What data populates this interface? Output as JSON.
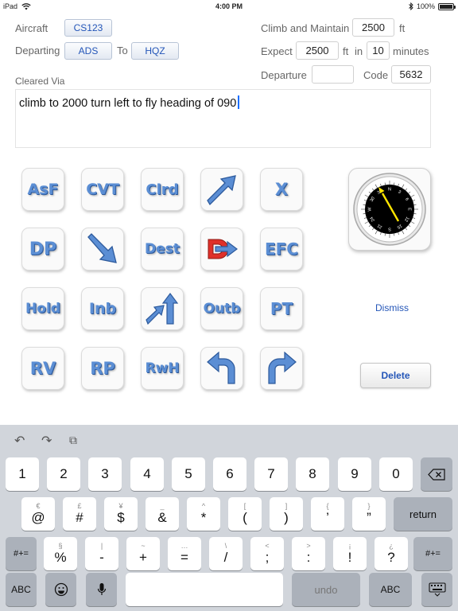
{
  "status": {
    "device": "iPad",
    "time": "4:00 PM",
    "battery": "100%",
    "battery_level": 1.0
  },
  "form": {
    "aircraft_label": "Aircraft",
    "aircraft_value": "CS123",
    "departing_label": "Departing",
    "departing_value": "ADS",
    "to_label": "To",
    "to_value": "HQZ",
    "cleared_via_label": "Cleared Via",
    "climb_label": "Climb and Maintain",
    "climb_value": "2500",
    "climb_unit": "ft",
    "expect_label": "Expect",
    "expect_value": "2500",
    "expect_unit": "ft",
    "in_label": "in",
    "in_value": "10",
    "minutes_label": "minutes",
    "departure_label": "Departure",
    "departure_value": "",
    "code_label": "Code",
    "code_value": "5632"
  },
  "clearance_text": "climb to 2000 turn left to  fly heading of 090",
  "tiles": [
    {
      "label": "AsF"
    },
    {
      "label": "CVT"
    },
    {
      "label": "Clrd"
    },
    {
      "icon": "arrow-up-right-icon"
    },
    {
      "label": "X"
    },
    {
      "label": "DP"
    },
    {
      "icon": "arrow-down-right-icon"
    },
    {
      "label": "Dest"
    },
    {
      "icon": "d-arrow-icon"
    },
    {
      "label": "EFC"
    },
    {
      "label": "Hold"
    },
    {
      "label": "Inb"
    },
    {
      "icon": "double-arrow-up-right-icon"
    },
    {
      "label": "Outb"
    },
    {
      "label": "PT"
    },
    {
      "label": "RV"
    },
    {
      "label": "RP"
    },
    {
      "label": "RwH"
    },
    {
      "icon": "turn-left-arrow-icon"
    },
    {
      "icon": "turn-right-arrow-icon"
    }
  ],
  "compass": {
    "labels": [
      "N",
      "3",
      "6",
      "E",
      "12",
      "15",
      "S",
      "21",
      "24",
      "W",
      "30",
      "33"
    ]
  },
  "dismiss_label": "Dismiss",
  "delete_label": "Delete",
  "keyboard": {
    "row1": [
      "1",
      "2",
      "3",
      "4",
      "5",
      "6",
      "7",
      "8",
      "9",
      "0"
    ],
    "row2": [
      {
        "main": "@",
        "sub": "€"
      },
      {
        "main": "#",
        "sub": "£"
      },
      {
        "main": "$",
        "sub": "¥"
      },
      {
        "main": "&",
        "sub": "_"
      },
      {
        "main": "*",
        "sub": "^"
      },
      {
        "main": "(",
        "sub": "["
      },
      {
        "main": ")",
        "sub": "]"
      },
      {
        "main": "’",
        "sub": "{"
      },
      {
        "main": "”",
        "sub": "}"
      }
    ],
    "row3": [
      {
        "main": "%",
        "sub": "§"
      },
      {
        "main": "-",
        "sub": "|"
      },
      {
        "main": "+",
        "sub": "~"
      },
      {
        "main": "=",
        "sub": "…"
      },
      {
        "main": "/",
        "sub": "\\"
      },
      {
        "main": ";",
        "sub": "<"
      },
      {
        "main": ":",
        "sub": ">"
      },
      {
        "main": "!",
        "sub": "¡"
      },
      {
        "main": "?",
        "sub": "¿"
      }
    ],
    "return_label": "return",
    "symbols_label": "#+=",
    "abc_label": "ABC",
    "undo_label": "undo"
  }
}
